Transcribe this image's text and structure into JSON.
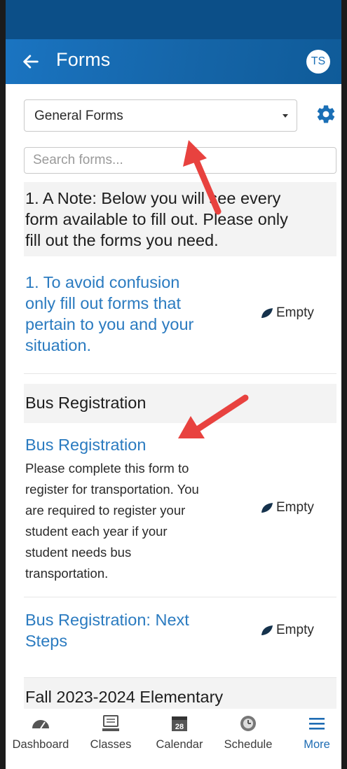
{
  "app_bar": {
    "title": "Forms",
    "avatar_initials": "TS"
  },
  "filter": {
    "selected": "General Forms"
  },
  "search": {
    "placeholder": "Search forms..."
  },
  "sections": [
    {
      "lines": [
        "1. A Note: Below you will see every",
        "form available to fill out. Please only",
        "fill out the forms you need."
      ]
    },
    {
      "lines": [
        "Bus Registration"
      ]
    },
    {
      "lines": [
        "Fall 2023-2024 Elementary"
      ]
    }
  ],
  "items": [
    {
      "title_lines": [
        "1. To avoid confusion",
        "only fill out forms that",
        "pertain to you and your",
        "situation."
      ],
      "status": "Empty"
    },
    {
      "title_lines": [
        "Bus Registration"
      ],
      "desc_lines": [
        "Please complete this form to",
        "register for transportation. You",
        "are required to register your",
        "student each year if your",
        "student needs bus",
        "transportation."
      ],
      "status": "Empty"
    },
    {
      "title_lines": [
        "Bus Registration: Next",
        "Steps"
      ],
      "status": "Empty"
    }
  ],
  "nav": [
    {
      "label": "Dashboard",
      "icon": "speedometer-icon"
    },
    {
      "label": "Classes",
      "icon": "monitor-icon"
    },
    {
      "label": "Calendar",
      "icon": "calendar-icon",
      "badge": "28"
    },
    {
      "label": "Schedule",
      "icon": "clock-icon"
    },
    {
      "label": "More",
      "icon": "hamburger-menu-icon",
      "active": true
    }
  ],
  "colors": {
    "app_bar": "#1a6fb6",
    "status_bar": "#0c4f88",
    "link": "#2b7bc0",
    "section_bg": "#f3f3f3",
    "active_nav": "#1e6cb3",
    "annotation_arrow": "#e8423f"
  }
}
